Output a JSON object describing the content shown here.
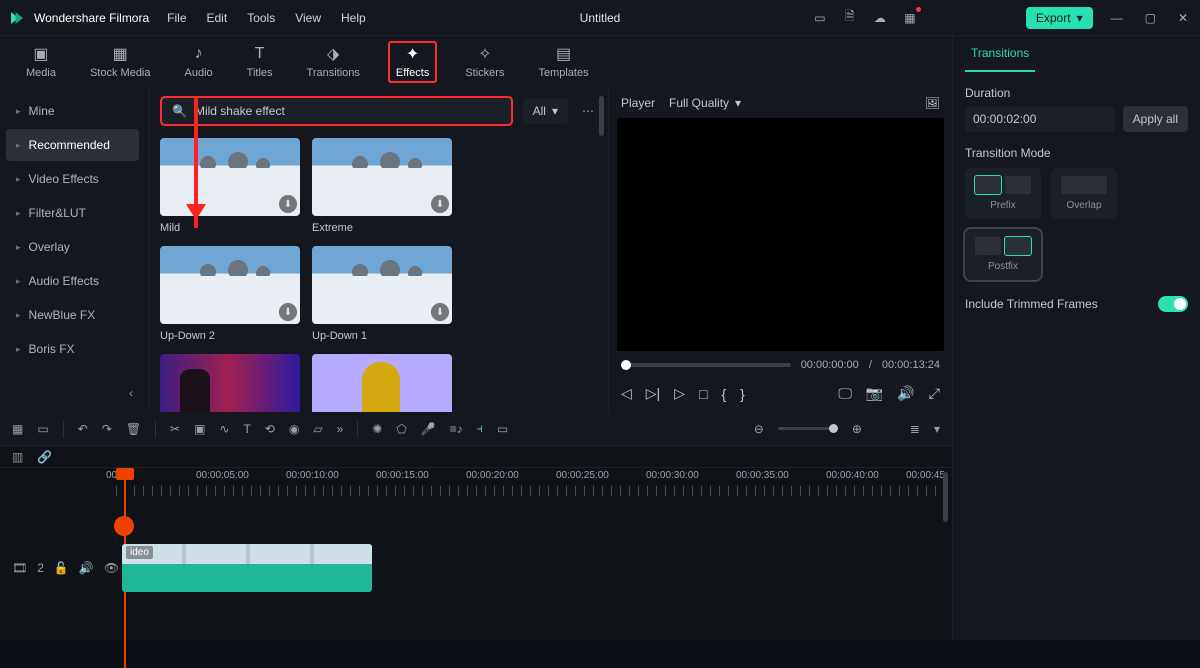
{
  "app": {
    "name": "Wondershare Filmora",
    "document": "Untitled"
  },
  "menu": {
    "file": "File",
    "edit": "Edit",
    "tools": "Tools",
    "view": "View",
    "help": "Help"
  },
  "title_actions": {
    "export": "Export"
  },
  "top_tabs": {
    "media": "Media",
    "stock": "Stock Media",
    "audio": "Audio",
    "titles": "Titles",
    "transitions": "Transitions",
    "effects": "Effects",
    "stickers": "Stickers",
    "templates": "Templates"
  },
  "sidebar": {
    "items": [
      {
        "label": "Mine"
      },
      {
        "label": "Recommended"
      },
      {
        "label": "Video Effects"
      },
      {
        "label": "Filter&LUT"
      },
      {
        "label": "Overlay"
      },
      {
        "label": "Audio Effects"
      },
      {
        "label": "NewBlue FX"
      },
      {
        "label": "Boris FX"
      }
    ]
  },
  "search": {
    "value": "Mild shake effect",
    "filter": "All"
  },
  "thumbs": [
    {
      "name": "Mild"
    },
    {
      "name": "Extreme"
    },
    {
      "name": "Up-Down 2"
    },
    {
      "name": "Up-Down 1"
    },
    {
      "name": ""
    },
    {
      "name": ""
    }
  ],
  "player": {
    "label": "Player",
    "quality": "Full Quality",
    "current": "00:00:00:00",
    "sep": "/",
    "total": "00:00:13:24"
  },
  "inspector": {
    "tab": "Transitions",
    "duration_label": "Duration",
    "duration_value": "00:00:02:00",
    "apply_all": "Apply all",
    "mode_label": "Transition Mode",
    "modes": {
      "prefix": "Prefix",
      "overlap": "Overlap",
      "postfix": "Postfix"
    },
    "trim_label": "Include Trimmed Frames"
  },
  "timeline": {
    "labels": [
      "00:00",
      "00:00:05:00",
      "00:00:10:00",
      "00:00:15:00",
      "00:00:20:00",
      "00:00:25:00",
      "00:00:30:00",
      "00:00:35:00",
      "00:00:40:00",
      "00:00:45"
    ],
    "track_count": "2",
    "clip_label": "ideo"
  }
}
